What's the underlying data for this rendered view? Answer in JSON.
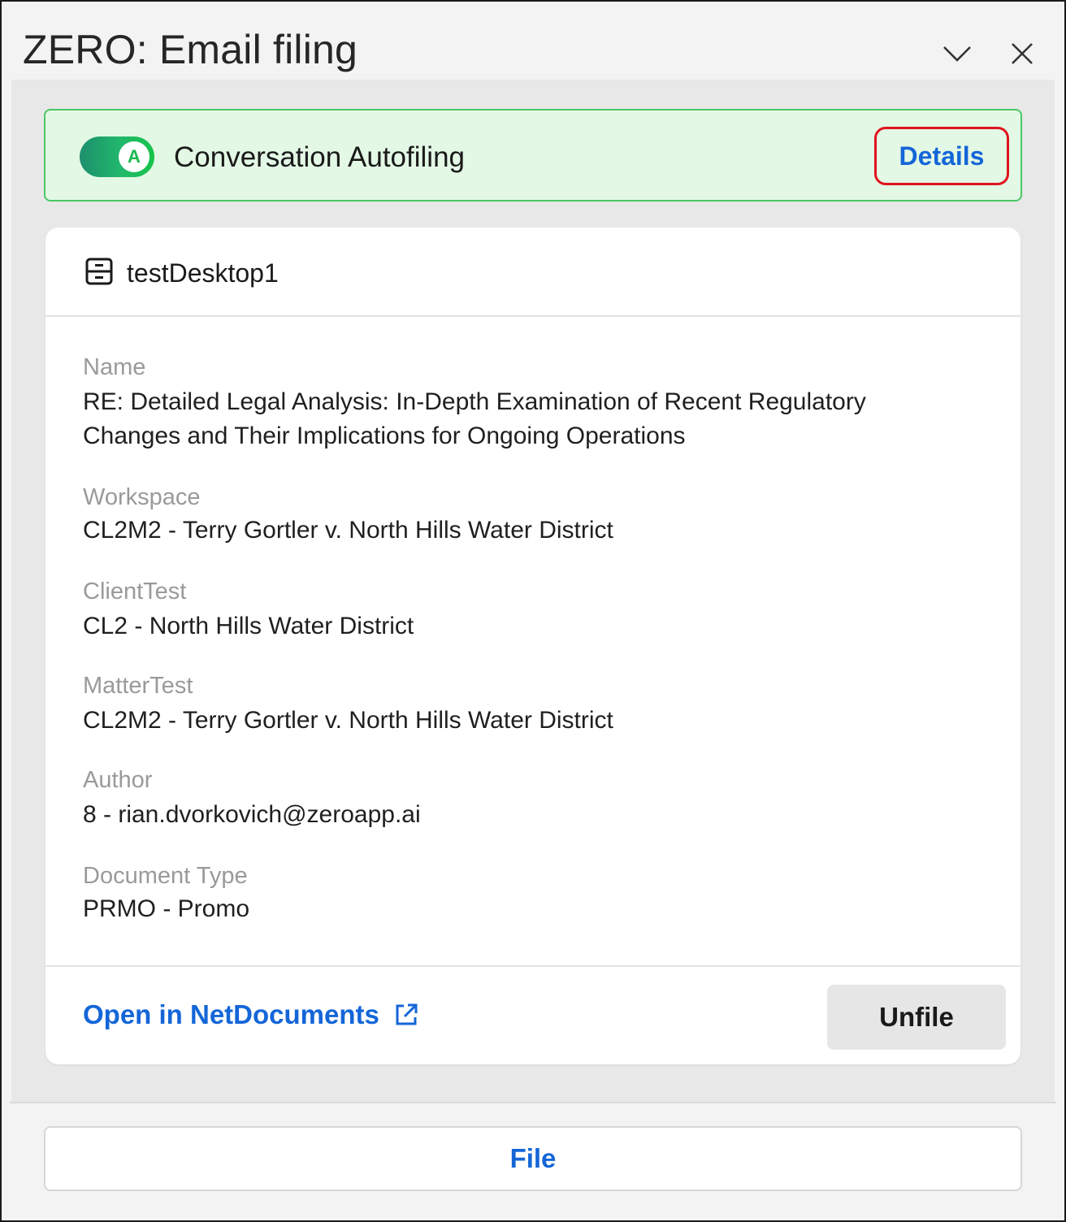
{
  "window": {
    "title": "ZERO: Email filing"
  },
  "banner": {
    "toggle_letter": "A",
    "label": "Conversation Autofiling",
    "details_label": "Details",
    "toggle_state": "on",
    "colors": {
      "bg": "#e3f8e5",
      "border": "#4cc764",
      "highlight": "#e0141e"
    }
  },
  "card": {
    "document_title": "testDesktop1",
    "fields": [
      {
        "label": "Name",
        "value_line1": "RE: Detailed Legal Analysis: In-Depth Examination of Recent Regulatory",
        "value_line2": "Changes and Their Implications for Ongoing Operations"
      },
      {
        "label": "Workspace",
        "value": "CL2M2 - Terry Gortler v. North Hills Water District"
      },
      {
        "label": "ClientTest",
        "value": "CL2 - North Hills Water District"
      },
      {
        "label": "MatterTest",
        "value": "CL2M2 - Terry Gortler v. North Hills Water District"
      },
      {
        "label": "Author",
        "value": "8 - rian.dvorkovich@zeroapp.ai"
      },
      {
        "label": "Document Type",
        "value": "PRMO - Promo"
      }
    ],
    "open_link_label": "Open in NetDocuments",
    "unfile_label": "Unfile"
  },
  "footer": {
    "file_label": "File"
  },
  "colors": {
    "accent": "#1466d8",
    "label_gray": "#9a9a9a"
  }
}
